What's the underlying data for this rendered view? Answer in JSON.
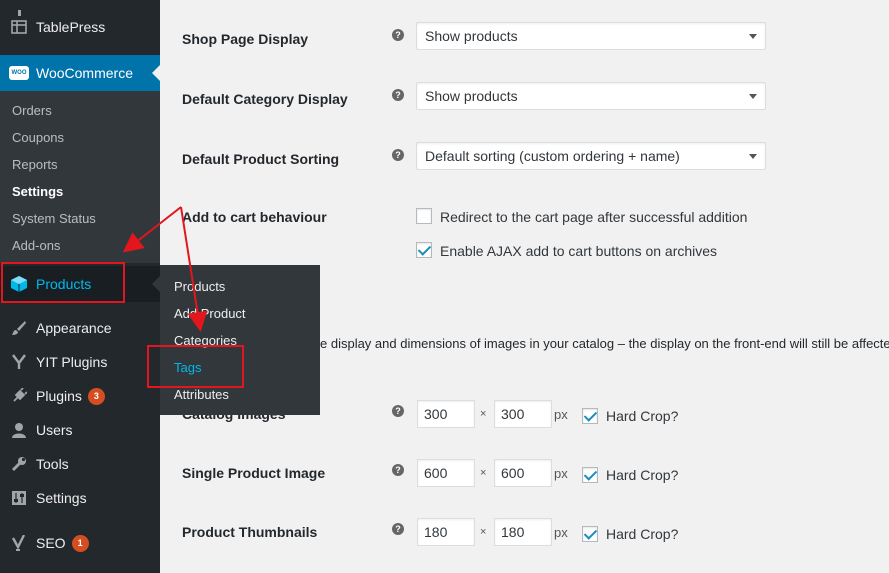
{
  "sidebar": {
    "tablepress": "TablePress",
    "woocommerce": "WooCommerce",
    "woo_submenu": [
      "Orders",
      "Coupons",
      "Reports",
      "Settings",
      "System Status",
      "Add-ons"
    ],
    "products": "Products",
    "appearance": "Appearance",
    "yit_plugins": "YIT Plugins",
    "plugins": "Plugins",
    "plugins_badge": "3",
    "users": "Users",
    "tools": "Tools",
    "settings": "Settings",
    "seo": "SEO",
    "seo_badge": "1",
    "woo_logo_text": "WOO"
  },
  "flyout": [
    "Products",
    "Add Product",
    "Categories",
    "Tags",
    "Attributes"
  ],
  "settings": {
    "shop_page_display": {
      "label": "Shop Page Display",
      "value": "Show products"
    },
    "default_category_display": {
      "label": "Default Category Display",
      "value": "Show products"
    },
    "default_product_sorting": {
      "label": "Default Product Sorting",
      "value": "Default sorting (custom ordering + name)"
    },
    "add_to_cart": {
      "label": "Add to cart behaviour",
      "redirect_label": "Redirect to the cart page after successful addition",
      "redirect_checked": false,
      "ajax_label": "Enable AJAX add to cart buttons on archives",
      "ajax_checked": true
    },
    "images_description": "e display and dimensions of images in your catalog – the display on the front-end will still be affecte",
    "catalog_images": {
      "label": "Catalog Images",
      "width": "300",
      "height": "300",
      "hard_crop": true
    },
    "single_product_image": {
      "label": "Single Product Image",
      "width": "600",
      "height": "600",
      "hard_crop": true
    },
    "product_thumbnails": {
      "label": "Product Thumbnails",
      "width": "180",
      "height": "180",
      "hard_crop": true
    },
    "times_symbol": "×",
    "px_unit": "px",
    "hard_crop_label": "Hard Crop?",
    "help_symbol": "?"
  },
  "colors": {
    "sidebar_bg": "#23282d",
    "active_blue": "#0073aa",
    "highlight_blue": "#00b9eb",
    "annotation_red": "#e2161c"
  }
}
